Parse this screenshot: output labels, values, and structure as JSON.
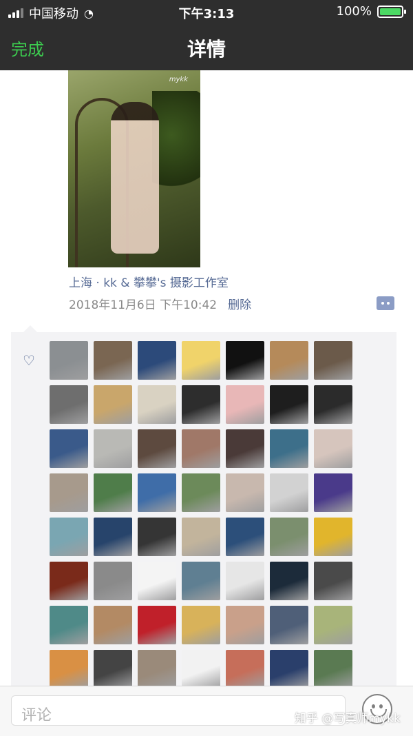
{
  "status_bar": {
    "carrier": "中国移动",
    "time": "下午3:13",
    "battery_text": "100%"
  },
  "nav": {
    "done_label": "完成",
    "title": "详情"
  },
  "photo": {
    "watermark": "mykk"
  },
  "post": {
    "location": "上海 · kk & 攀攀's 摄影工作室",
    "timestamp": "2018年11月6日 下午10:42",
    "delete_label": "删除"
  },
  "likes": {
    "avatar_colors": [
      "#8b8f92",
      "#7a6652",
      "#2c4a7a",
      "#f0d36a",
      "#111111",
      "#b58a5a",
      "#6b5a4a",
      "#6e6e6e",
      "#c9a66b",
      "#d9d2c2",
      "#2d2d2d",
      "#e8b7b7",
      "#1e1e1e",
      "#2b2b2b",
      "#3a5a8a",
      "#b9b9b5",
      "#5d4a3f",
      "#a07868",
      "#4a3a38",
      "#3d6f8a",
      "#d6c5bd",
      "#a79a8c",
      "#4f7d4a",
      "#3f6da8",
      "#6c8a5a",
      "#c8b8ae",
      "#d2d2d2",
      "#4a3a8a",
      "#7aa6b2",
      "#27446b",
      "#353535",
      "#c2b49c",
      "#2c4f7a",
      "#7b8f6e",
      "#e1b52c",
      "#7a2a1a",
      "#8a8a8a",
      "#f4f4f4",
      "#5f7f92",
      "#e6e6e6",
      "#1c2b3a",
      "#4a4a4a",
      "#4f8a88",
      "#b38a64",
      "#c0202a",
      "#d8b25a",
      "#c9a08a",
      "#4f5f78",
      "#a8b47a",
      "#d99044",
      "#444444",
      "#9a8a7a",
      "#f2f2f2",
      "#c66e5a",
      "#2a3f6b",
      "#5a7a52"
    ]
  },
  "comment_bar": {
    "placeholder": "评论",
    "emoji_icon": "smiley-face-icon"
  },
  "watermark": "知乎 @写真师mykk"
}
